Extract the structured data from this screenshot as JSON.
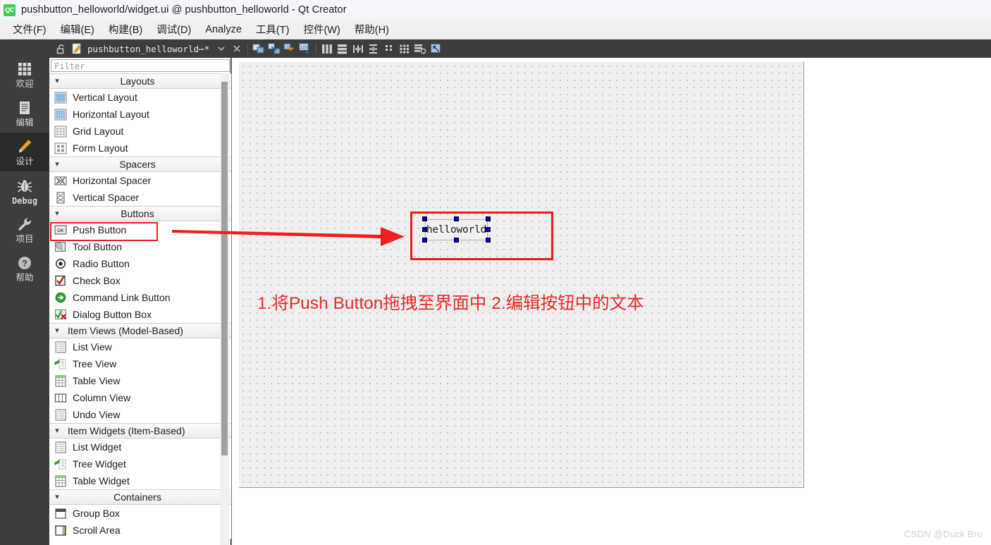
{
  "window": {
    "title": "pushbutton_helloworld/widget.ui @ pushbutton_helloworld - Qt Creator",
    "logo_text": "QC",
    "logo_icon": "qt-creator-logo-icon"
  },
  "menubar": {
    "items": [
      {
        "label": "文件(F)",
        "name": "menu-file"
      },
      {
        "label": "编辑(E)",
        "name": "menu-edit"
      },
      {
        "label": "构建(B)",
        "name": "menu-build"
      },
      {
        "label": "调试(D)",
        "name": "menu-debug"
      },
      {
        "label": "Analyze",
        "name": "menu-analyze"
      },
      {
        "label": "工具(T)",
        "name": "menu-tools"
      },
      {
        "label": "控件(W)",
        "name": "menu-widgets"
      },
      {
        "label": "帮助(H)",
        "name": "menu-help"
      }
    ]
  },
  "modebar": {
    "items": [
      {
        "label": "欢迎",
        "icon": "grid-icon",
        "active": false
      },
      {
        "label": "编辑",
        "icon": "document-icon",
        "active": false
      },
      {
        "label": "设计",
        "icon": "pencil-icon",
        "active": true
      },
      {
        "label": "Debug",
        "icon": "bug-icon",
        "active": false
      },
      {
        "label": "项目",
        "icon": "wrench-icon",
        "active": false
      },
      {
        "label": "帮助",
        "icon": "question-icon",
        "active": false
      }
    ]
  },
  "toolstrip": {
    "filename": "pushbutton_helloworld⋯*",
    "lock_icon": "unlock-icon",
    "file_icon": "ui-file-icon",
    "dropdown_icon": "chevron-down-icon",
    "close_icon": "close-icon",
    "tools": [
      "edit-widgets-icon",
      "edit-signals-slots-icon",
      "edit-buddies-icon",
      "edit-tab-order-icon",
      "layout-horizontally-icon",
      "layout-vertically-icon",
      "layout-horizontal-splitter-icon",
      "layout-vertical-splitter-icon",
      "layout-form-icon",
      "layout-grid-icon",
      "break-layout-icon",
      "adjust-size-icon"
    ]
  },
  "widgetbox": {
    "filter_placeholder": "Filter",
    "filter_value": "",
    "scrollbar": "vertical-scrollbar",
    "groups": [
      {
        "name": "Layouts",
        "centered": true,
        "items": [
          {
            "label": "Vertical Layout",
            "icon": "vertical-layout-icon"
          },
          {
            "label": "Horizontal Layout",
            "icon": "horizontal-layout-icon"
          },
          {
            "label": "Grid Layout",
            "icon": "grid-layout-icon"
          },
          {
            "label": "Form Layout",
            "icon": "form-layout-icon"
          }
        ]
      },
      {
        "name": "Spacers",
        "centered": true,
        "items": [
          {
            "label": "Horizontal Spacer",
            "icon": "horizontal-spacer-icon"
          },
          {
            "label": "Vertical Spacer",
            "icon": "vertical-spacer-icon"
          }
        ]
      },
      {
        "name": "Buttons",
        "centered": true,
        "items": [
          {
            "label": "Push Button",
            "icon": "push-button-icon",
            "highlighted": true
          },
          {
            "label": "Tool Button",
            "icon": "tool-button-icon"
          },
          {
            "label": "Radio Button",
            "icon": "radio-button-icon"
          },
          {
            "label": "Check Box",
            "icon": "check-box-icon"
          },
          {
            "label": "Command Link Button",
            "icon": "command-link-button-icon"
          },
          {
            "label": "Dialog Button Box",
            "icon": "dialog-button-box-icon"
          }
        ]
      },
      {
        "name": "Item Views (Model-Based)",
        "centered": false,
        "items": [
          {
            "label": "List View",
            "icon": "list-view-icon"
          },
          {
            "label": "Tree View",
            "icon": "tree-view-icon"
          },
          {
            "label": "Table View",
            "icon": "table-view-icon"
          },
          {
            "label": "Column View",
            "icon": "column-view-icon"
          },
          {
            "label": "Undo View",
            "icon": "undo-view-icon"
          }
        ]
      },
      {
        "name": "Item Widgets (Item-Based)",
        "centered": false,
        "items": [
          {
            "label": "List Widget",
            "icon": "list-widget-icon"
          },
          {
            "label": "Tree Widget",
            "icon": "tree-widget-icon"
          },
          {
            "label": "Table Widget",
            "icon": "table-widget-icon"
          }
        ]
      },
      {
        "name": "Containers",
        "centered": true,
        "items": [
          {
            "label": "Group Box",
            "icon": "group-box-icon"
          },
          {
            "label": "Scroll Area",
            "icon": "scroll-area-icon"
          }
        ]
      }
    ]
  },
  "canvas": {
    "button": {
      "text": "helloworld",
      "selected": true,
      "handles": 8
    }
  },
  "annotations": {
    "step_text": "1.将Push Button拖拽至界面中  2.编辑按钮中的文本",
    "arrow": "red-arrow-annotation",
    "box_on_canvas": "red-highlight-box-canvas",
    "box_on_push_button": "red-highlight-box-push-button",
    "accent_color": "#ee2b2b"
  },
  "watermark": {
    "text": "CSDN @Duck Bro"
  }
}
